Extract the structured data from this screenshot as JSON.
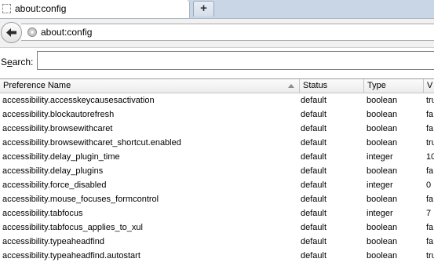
{
  "tab": {
    "title": "about:config",
    "new_tab_label": "+"
  },
  "navbar": {
    "url": "about:config"
  },
  "search": {
    "label_prefix": "S",
    "label_underlined": "e",
    "label_suffix": "arch:",
    "value": ""
  },
  "table": {
    "headers": [
      "Preference Name",
      "Status",
      "Type",
      "V"
    ],
    "rows": [
      {
        "name": "accessibility.accesskeycausesactivation",
        "status": "default",
        "type": "boolean",
        "value": "tru"
      },
      {
        "name": "accessibility.blockautorefresh",
        "status": "default",
        "type": "boolean",
        "value": "fa"
      },
      {
        "name": "accessibility.browsewithcaret",
        "status": "default",
        "type": "boolean",
        "value": "fa"
      },
      {
        "name": "accessibility.browsewithcaret_shortcut.enabled",
        "status": "default",
        "type": "boolean",
        "value": "tru"
      },
      {
        "name": "accessibility.delay_plugin_time",
        "status": "default",
        "type": "integer",
        "value": "10"
      },
      {
        "name": "accessibility.delay_plugins",
        "status": "default",
        "type": "boolean",
        "value": "fa"
      },
      {
        "name": "accessibility.force_disabled",
        "status": "default",
        "type": "integer",
        "value": "0"
      },
      {
        "name": "accessibility.mouse_focuses_formcontrol",
        "status": "default",
        "type": "boolean",
        "value": "fa"
      },
      {
        "name": "accessibility.tabfocus",
        "status": "default",
        "type": "integer",
        "value": "7"
      },
      {
        "name": "accessibility.tabfocus_applies_to_xul",
        "status": "default",
        "type": "boolean",
        "value": "fa"
      },
      {
        "name": "accessibility.typeaheadfind",
        "status": "default",
        "type": "boolean",
        "value": "fa"
      },
      {
        "name": "accessibility.typeaheadfind.autostart",
        "status": "default",
        "type": "boolean",
        "value": "tru"
      }
    ]
  }
}
